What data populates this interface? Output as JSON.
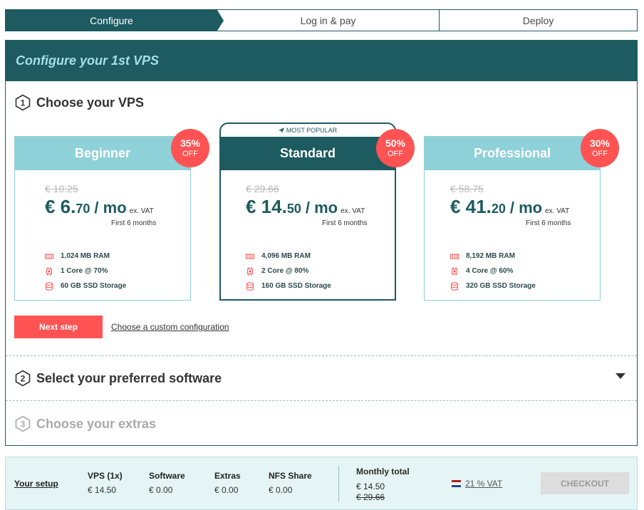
{
  "steps": {
    "configure": "Configure",
    "login_pay": "Log in & pay",
    "deploy": "Deploy"
  },
  "panel": {
    "header": "Configure your 1st VPS"
  },
  "section1": {
    "number": "1",
    "title": "Choose your VPS"
  },
  "section2": {
    "number": "2",
    "title": "Select your preferred software"
  },
  "section3": {
    "number": "3",
    "title": "Choose your extras"
  },
  "plans": [
    {
      "name": "Beginner",
      "discount": "35%",
      "off": "OFF",
      "old_price": "€ 10.25",
      "price_int": "€ 6.",
      "price_dec": "70",
      "unit": "/ mo",
      "vat": "ex. VAT",
      "period": "First 6 months",
      "specs": [
        "1,024 MB RAM",
        "1 Core @ 70%",
        "60 GB SSD Storage"
      ]
    },
    {
      "name": "Standard",
      "tag": "MOST POPULAR",
      "discount": "50%",
      "off": "OFF",
      "old_price": "€ 29.66",
      "price_int": "€ 14.",
      "price_dec": "50",
      "unit": "/ mo",
      "vat": "ex. VAT",
      "period": "First 6 months",
      "specs": [
        "4,096 MB RAM",
        "2 Core @ 80%",
        "160 GB SSD Storage"
      ]
    },
    {
      "name": "Professional",
      "discount": "30%",
      "off": "OFF",
      "old_price": "€ 58.75",
      "price_int": "€ 41.",
      "price_dec": "20",
      "unit": "/ mo",
      "vat": "ex. VAT",
      "period": "First 6 months",
      "specs": [
        "8,192 MB RAM",
        "4 Core @ 60%",
        "320 GB SSD Storage"
      ]
    }
  ],
  "actions": {
    "next_step": "Next step",
    "custom_config": "Choose a custom configuration"
  },
  "footer": {
    "your_setup": "Your setup",
    "vps_label": "VPS (1x)",
    "vps_value": "€ 14.50",
    "software_label": "Software",
    "software_value": "€ 0.00",
    "extras_label": "Extras",
    "extras_value": "€ 0.00",
    "nfs_label": "NFS Share",
    "nfs_value": "€ 0.00",
    "monthly_label": "Monthly total",
    "monthly_value": "€ 14.50",
    "monthly_old": "€ 29.66",
    "vat": "21 % VAT",
    "checkout": "CHECKOUT"
  },
  "colors": {
    "primary": "#1d5b60",
    "light": "#8fd1d8",
    "accent": "#ff5353"
  },
  "icons": {
    "ram": "memory-icon",
    "cpu": "cpu-icon",
    "storage": "database-icon",
    "popular": "send-icon",
    "flag": "netherlands-flag-icon"
  }
}
